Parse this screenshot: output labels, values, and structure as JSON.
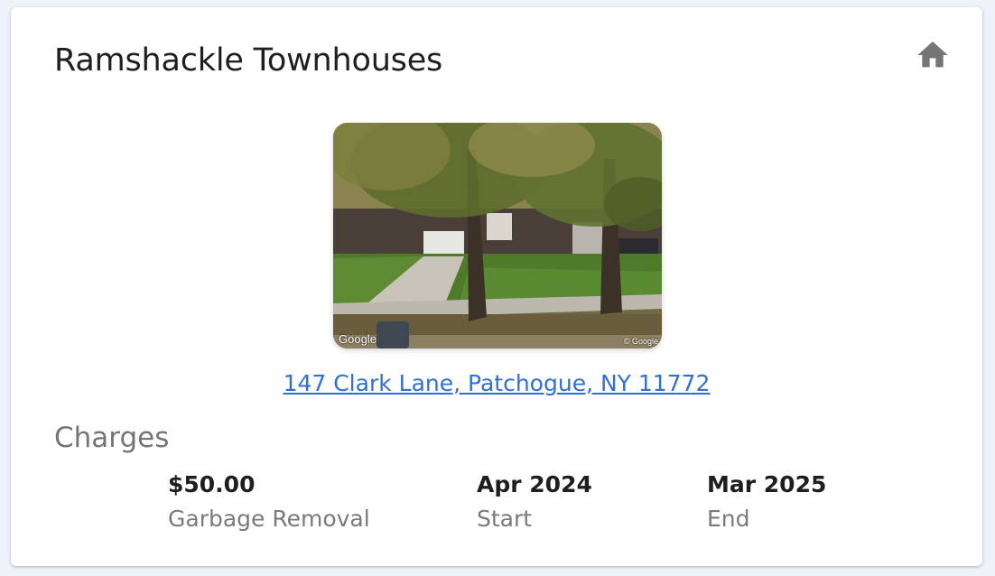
{
  "property": {
    "name": "Ramshackle Townhouses",
    "address": "147 Clark Lane, Patchogue, NY 11772",
    "photo_watermark": "Google",
    "photo_copyright": "© Google"
  },
  "icons": {
    "home": "home-icon"
  },
  "colors": {
    "link": "#2f6fd6",
    "icon": "#757575"
  },
  "charges": {
    "label": "Charges",
    "items": [
      {
        "amount": "$50.00",
        "description": "Garbage Removal",
        "start_value": "Apr 2024",
        "start_label": "Start",
        "end_value": "Mar 2025",
        "end_label": "End"
      }
    ]
  }
}
